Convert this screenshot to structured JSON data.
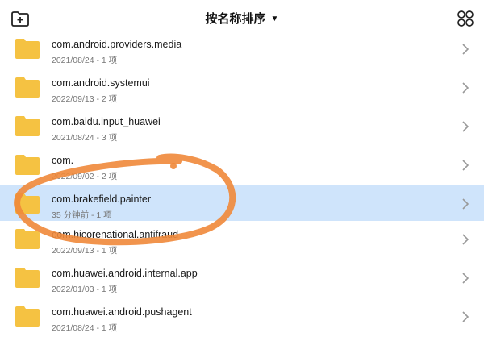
{
  "header": {
    "sort_label": "按名称排序",
    "new_folder_icon": "new-folder-icon",
    "view_toggle_icon": "grid-view-icon"
  },
  "colors": {
    "folder": "#f5c242",
    "selected": "#cfe4fb",
    "annotation": "#f0883a"
  },
  "items": [
    {
      "name": "com.android.providers.media",
      "meta": "2021/08/24 - 1 项"
    },
    {
      "name": "com.android.systemui",
      "meta": "2022/09/13 - 2 项"
    },
    {
      "name": "com.baidu.input_huawei",
      "meta": "2021/08/24 - 3 项"
    },
    {
      "name": "com.",
      "meta": "2022/09/02 - 2 项"
    },
    {
      "name": "com.brakefield.painter",
      "meta": "35 分钟前 - 1 项"
    },
    {
      "name": "com.hicorenational.antifraud",
      "meta": "2022/09/13 - 1 项"
    },
    {
      "name": "com.huawei.android.internal.app",
      "meta": "2022/01/03 - 1 项"
    },
    {
      "name": "com.huawei.android.pushagent",
      "meta": "2021/08/24 - 1 项"
    }
  ]
}
